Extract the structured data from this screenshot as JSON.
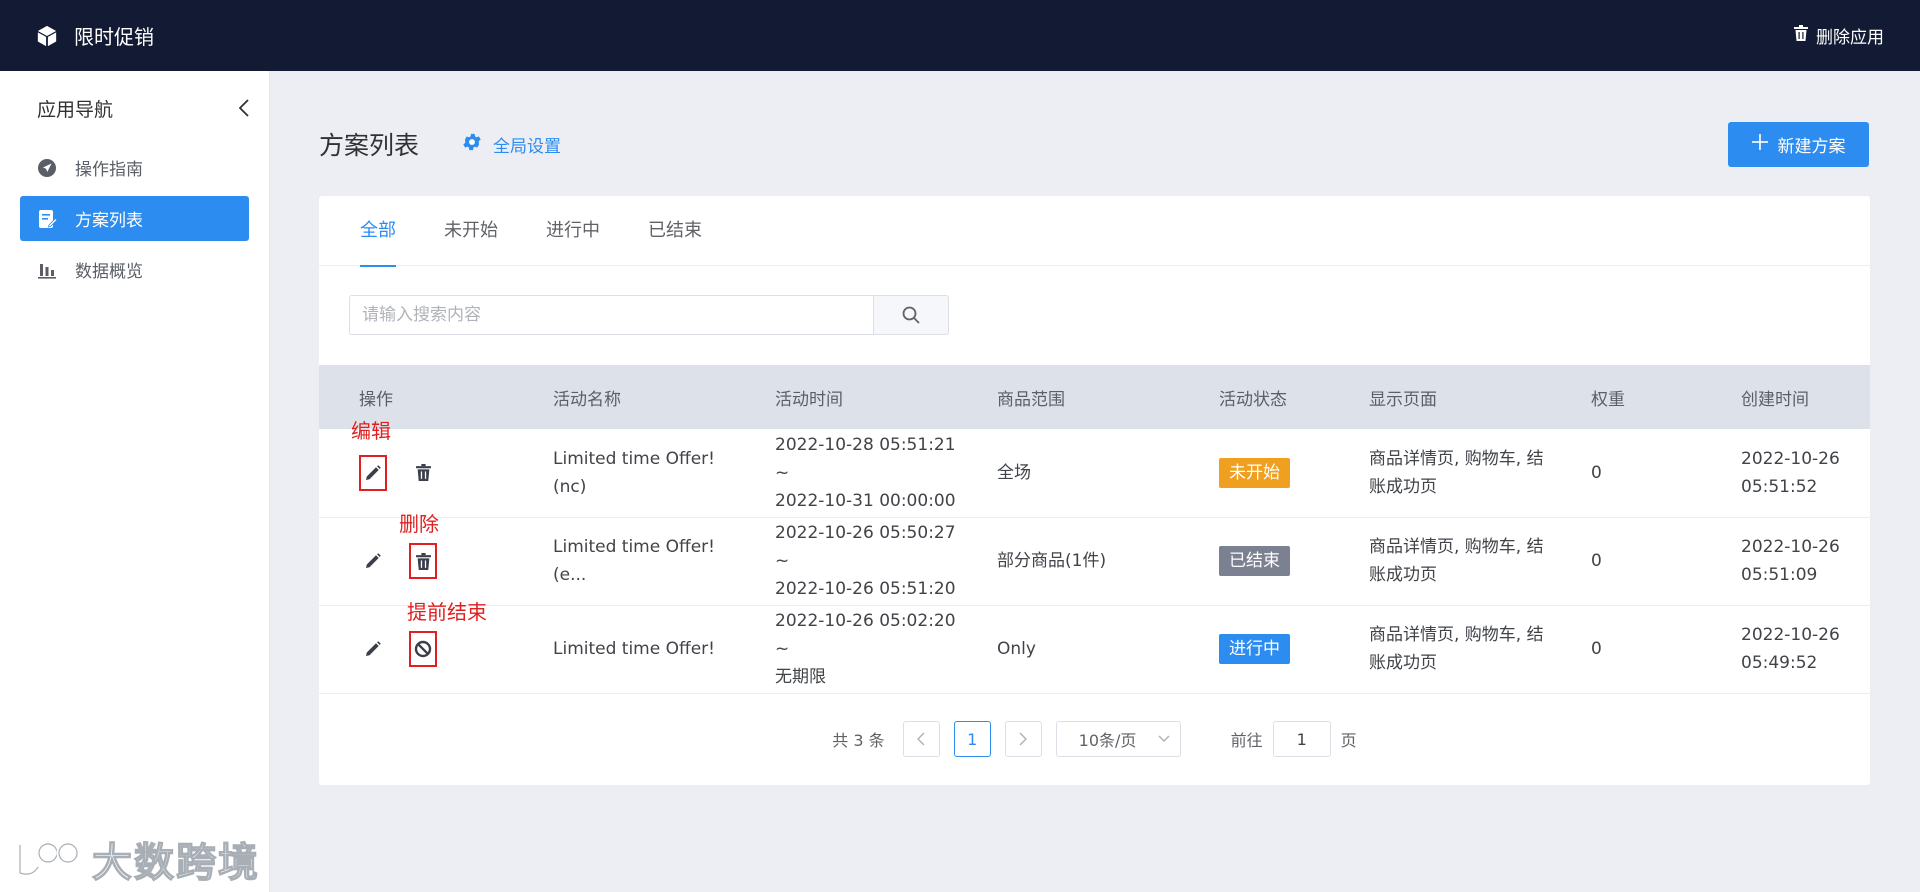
{
  "topbar": {
    "app_title": "限时促销",
    "delete_app_label": "删除应用"
  },
  "sidebar": {
    "header": "应用导航",
    "items": [
      {
        "label": "操作指南",
        "icon": "send-icon"
      },
      {
        "label": "方案列表",
        "icon": "edit-list-icon",
        "active": true
      },
      {
        "label": "数据概览",
        "icon": "bar-chart-icon"
      }
    ]
  },
  "page": {
    "title": "方案列表",
    "global_settings_label": "全局设置",
    "new_plan_label": "新建方案"
  },
  "tabs": [
    {
      "label": "全部",
      "active": true
    },
    {
      "label": "未开始"
    },
    {
      "label": "进行中"
    },
    {
      "label": "已结束"
    }
  ],
  "search": {
    "placeholder": "请输入搜索内容",
    "value": ""
  },
  "table": {
    "headers": [
      "操作",
      "活动名称",
      "活动时间",
      "商品范围",
      "活动状态",
      "显示页面",
      "权重",
      "创建时间"
    ],
    "rows": [
      {
        "name": "Limited time Offer!(nc)",
        "time_start": "2022-10-28 05:51:21 ~",
        "time_end": "2022-10-31 00:00:00",
        "scope": "全场",
        "status": "未开始",
        "pages_line1": "商品详情页, 购物车, 结",
        "pages_line2": "账成功页",
        "weight": "0",
        "created_date": "2022-10-26",
        "created_time": "05:51:52"
      },
      {
        "name": "Limited time Offer!(e...",
        "time_start": "2022-10-26 05:50:27 ~",
        "time_end": "2022-10-26 05:51:20",
        "scope": "部分商品(1件)",
        "status": "已结束",
        "pages_line1": "商品详情页, 购物车, 结",
        "pages_line2": "账成功页",
        "weight": "0",
        "created_date": "2022-10-26",
        "created_time": "05:51:09"
      },
      {
        "name": "Limited time Offer!",
        "time_start": "2022-10-26 05:02:20 ~",
        "time_end": "无期限",
        "scope": "Only",
        "status": "进行中",
        "pages_line1": "商品详情页, 购物车, 结",
        "pages_line2": "账成功页",
        "weight": "0",
        "created_date": "2022-10-26",
        "created_time": "05:49:52"
      }
    ]
  },
  "status_colors": {
    "未开始": "#f0a020",
    "已结束": "#7b8191",
    "进行中": "#2d8cf0"
  },
  "annotations": {
    "edit": "编辑",
    "delete": "删除",
    "end_early": "提前结束"
  },
  "pagination": {
    "total": "共 3 条",
    "current_page": "1",
    "page_size": "10条/页",
    "goto_prefix": "前往",
    "goto_value": "1",
    "goto_suffix": "页"
  },
  "watermark": {
    "text": "大数跨境"
  }
}
